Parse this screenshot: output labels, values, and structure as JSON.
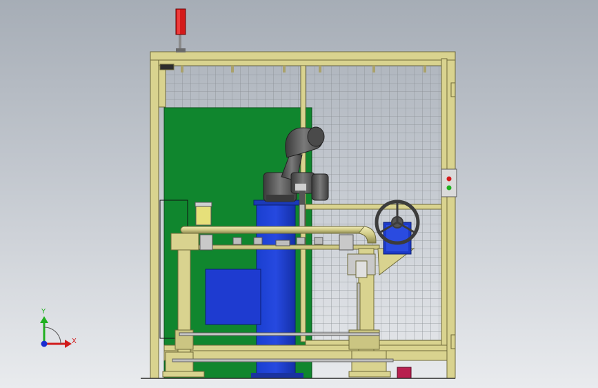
{
  "viewport": {
    "background_top": "#a6adb6",
    "background_bottom": "#e9ebee"
  },
  "triad": {
    "y_label": "Y",
    "x_label": "X",
    "y_color": "#1fb01f",
    "x_color": "#d11a1a",
    "origin_color": "#1a2dd1"
  },
  "colors": {
    "frame": "#d9d38f",
    "frame_edge": "#6e6a3a",
    "panel_green": "#10862e",
    "column_blue": "#1736b8",
    "robot": "#5a5a5a",
    "signal_tower": "#d41a1a",
    "control_box": "#b8204f",
    "mesh": "#8a8f94"
  },
  "icons": {
    "signal_tower": "signal-tower-icon",
    "handwheel": "handwheel-icon",
    "robot_arm": "robot-arm-icon",
    "control_panel": "control-panel-icon",
    "triad": "axis-triad-icon"
  }
}
